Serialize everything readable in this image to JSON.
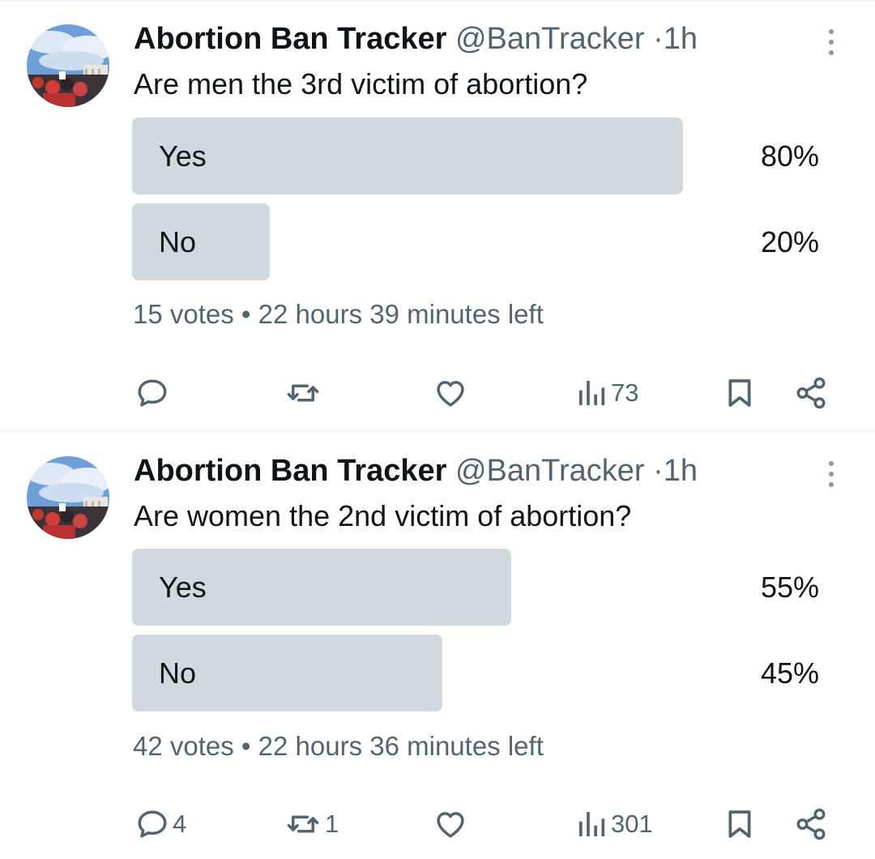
{
  "tweets": [
    {
      "author": "Abortion Ban Tracker",
      "handle": "@BanTracker",
      "separator": "·",
      "time": "1h",
      "question": "Are men the 3rd victim of abortion?",
      "options": [
        {
          "label": "Yes",
          "percent_text": "80%",
          "percent": 80
        },
        {
          "label": "No",
          "percent_text": "20%",
          "percent": 20
        }
      ],
      "votes": "15 votes",
      "meta_separator": "•",
      "time_left": "22 hours 39 minutes left",
      "actions": {
        "replies": "",
        "reposts": "",
        "views": "73"
      }
    },
    {
      "author": "Abortion Ban Tracker",
      "handle": "@BanTracker",
      "separator": "·",
      "time": "1h",
      "question": "Are women the 2nd victim of abortion?",
      "options": [
        {
          "label": "Yes",
          "percent_text": "55%",
          "percent": 55
        },
        {
          "label": "No",
          "percent_text": "45%",
          "percent": 45
        }
      ],
      "votes": "42 votes",
      "meta_separator": "•",
      "time_left": "22 hours 36 minutes left",
      "actions": {
        "replies": "4",
        "reposts": "1",
        "views": "301"
      }
    }
  ],
  "icons": [
    "reply-icon",
    "repost-icon",
    "like-icon",
    "views-icon",
    "bookmark-icon",
    "share-icon",
    "more-icon"
  ],
  "colors": {
    "poll_bar": "#cfd9de",
    "secondary_text": "#536471",
    "primary_text": "#0f1419"
  }
}
